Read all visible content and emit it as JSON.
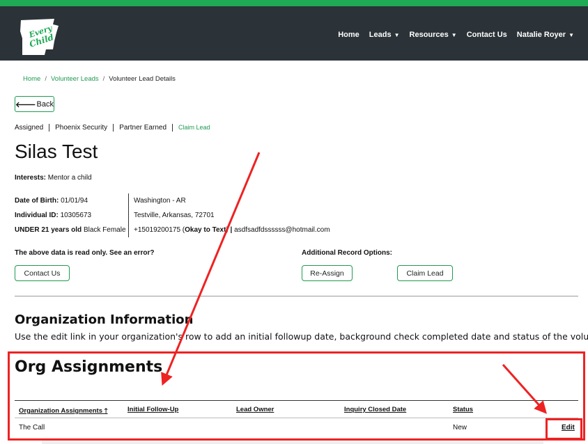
{
  "nav": {
    "home": "Home",
    "leads": "Leads",
    "resources": "Resources",
    "contact": "Contact Us",
    "user": "Natalie Royer"
  },
  "logo": {
    "text_top": "Every",
    "text_bottom": "Child"
  },
  "breadcrumb": {
    "home": "Home",
    "volunteer_leads": "Volunteer Leads",
    "current": "Volunteer Lead Details"
  },
  "back_label": "Back",
  "status": {
    "assigned": "Assigned",
    "org": "Phoenix Security",
    "earned": "Partner Earned",
    "claim": "Claim Lead"
  },
  "person": {
    "name": "Silas Test",
    "interests_label": "Interests:",
    "interests_value": "Mentor a child",
    "dob_label": "Date of Birth:",
    "dob_value": "01/01/94",
    "id_label": "Individual ID:",
    "id_value": "10305673",
    "age_label": "UNDER 21 years old",
    "demographic": "Black Female",
    "county": "Washington - AR",
    "address": "Testville, Arkansas, 72701",
    "phone": "+15019200175 (",
    "text_ok": "Okay to Text",
    "phone_close": ")",
    "email_sep": " | ",
    "email": "asdfsadfdssssss@hotmail.com"
  },
  "readonly_text": "The above data is read only. See an error?",
  "contact_button": "Contact Us",
  "additional_text": "Additional Record Options:",
  "reassign_button": "Re-Assign",
  "claim_button": "Claim Lead",
  "org_info": {
    "title": "Organization Information",
    "description": "Use the edit link in your organization's row to add an initial followup date, background check completed date and status of the volunteer."
  },
  "assignments": {
    "title": "Org Assignments",
    "columns": [
      "Organization Assignments",
      "Initial Follow-Up",
      "Lead Owner",
      "Inquiry Closed Date",
      "Status"
    ],
    "sort_icon": "arrow-up-icon",
    "rows": [
      {
        "organization": "The Call",
        "follow_up": "",
        "lead_owner": "",
        "closed_date": "",
        "status": "New",
        "action": "Edit"
      }
    ]
  },
  "colors": {
    "brand_green": "#1faa55",
    "navbar": "#2b3338",
    "link_green": "#1f9a52",
    "annotation_red": "#ee2222"
  }
}
